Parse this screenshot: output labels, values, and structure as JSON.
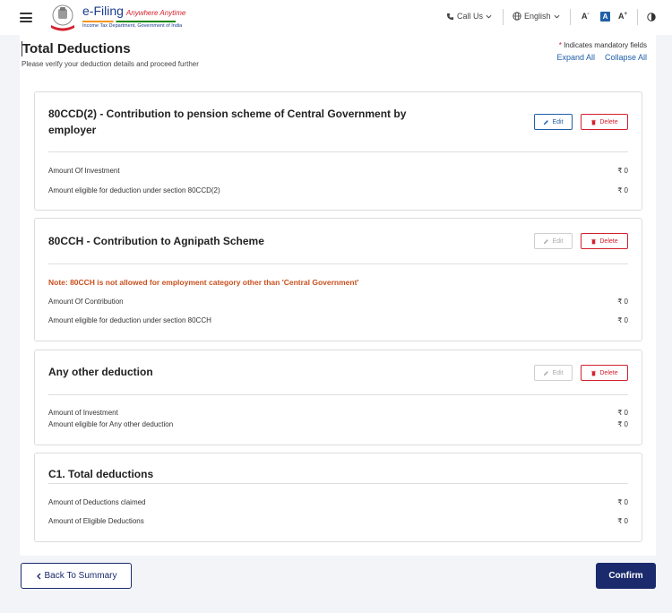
{
  "header": {
    "brand_name": "e-Filing",
    "brand_tagline": "Anywhere Anytime",
    "brand_subtitle": "Income Tax Department, Government of India",
    "call_us": "Call Us",
    "language": "English",
    "font_decrease": "A",
    "font_default": "A",
    "font_increase": "A"
  },
  "page": {
    "title": "Total Deductions",
    "subtitle": "Please verify your deduction details and proceed further",
    "mandatory_star": "*",
    "mandatory_text": "Indicates mandatory fields",
    "expand_all": "Expand All",
    "collapse_all": "Collapse All"
  },
  "buttons": {
    "edit": "Edit",
    "delete": "Delete"
  },
  "cards": [
    {
      "title_line1": "80CCD(2) - Contribution to pension scheme of Central Government by",
      "title_line2": "employer",
      "rows": [
        {
          "label": "Amount Of Investment",
          "value": "₹ 0"
        },
        {
          "label": "Amount eligible for deduction under section 80CCD(2)",
          "value": "₹ 0"
        }
      ]
    },
    {
      "title": "80CCH - Contribution to Agnipath Scheme",
      "note": "Note: 80CCH is not allowed for employment category other than 'Central Government'",
      "rows": [
        {
          "label": "Amount Of Contribution",
          "value": "₹ 0"
        },
        {
          "label": "Amount eligible for deduction under section 80CCH",
          "value": "₹ 0"
        }
      ]
    },
    {
      "title": "Any other deduction",
      "rows": [
        {
          "label": "Amount of Investment",
          "value": "₹ 0"
        },
        {
          "label": "Amount eligible for Any other deduction",
          "value": "₹ 0"
        }
      ]
    },
    {
      "title": "C1. Total deductions",
      "rows": [
        {
          "label": "Amount of Deductions claimed",
          "value": "₹ 0"
        },
        {
          "label": "Amount of Eligible Deductions",
          "value": "₹ 0"
        }
      ]
    }
  ],
  "footer": {
    "back": "Back To Summary",
    "confirm": "Confirm"
  }
}
